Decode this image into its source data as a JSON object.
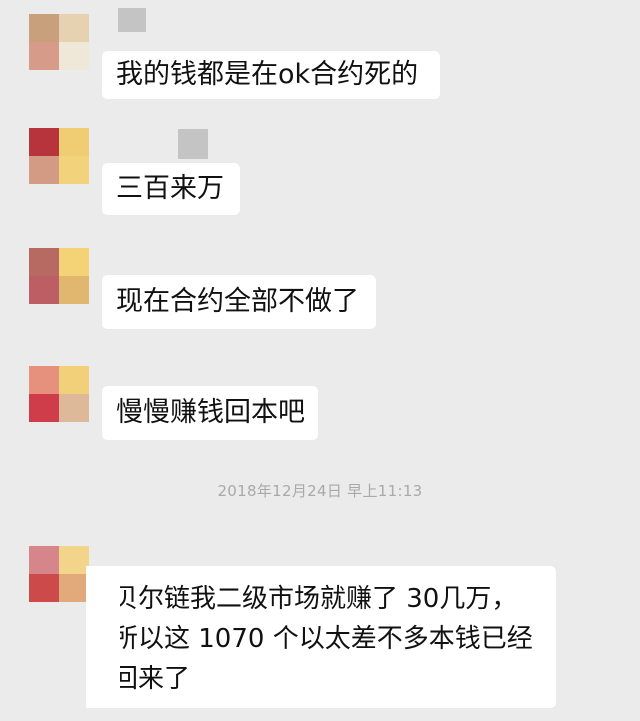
{
  "chat": {
    "messages": [
      {
        "text": "我的钱都是在ok合约死的",
        "avatar_colors": [
          "#c8a07c",
          "#e6d2b0",
          "#d69c89",
          "#efe8d8"
        ]
      },
      {
        "text": "三百来万",
        "avatar_colors": [
          "#b8343c",
          "#f0cc72",
          "#d39b84",
          "#f2d37c"
        ]
      },
      {
        "text": "现在合约全部不做了",
        "avatar_colors": [
          "#b66a62",
          "#f3d376",
          "#bd5e64",
          "#e1b66e"
        ]
      },
      {
        "text": "慢慢赚钱回本吧",
        "avatar_colors": [
          "#e5917d",
          "#f2d07a",
          "#cf3d4a",
          "#ddb999"
        ]
      }
    ],
    "timestamp": "2018年12月24日 早上11:13",
    "last_message": {
      "lines": [
        "贝尔链我二级市场就赚了 30几万，",
        "所以这 1070 个以太差不多本钱已经",
        "回来了"
      ],
      "avatar_colors": [
        "#d6858a",
        "#f2d58a",
        "#cd4a4a",
        "#e2aa7a"
      ]
    }
  },
  "colors": {
    "background": "#ebebeb",
    "bubble": "#ffffff",
    "text": "#111111",
    "timestamp": "#a9a9a9"
  }
}
